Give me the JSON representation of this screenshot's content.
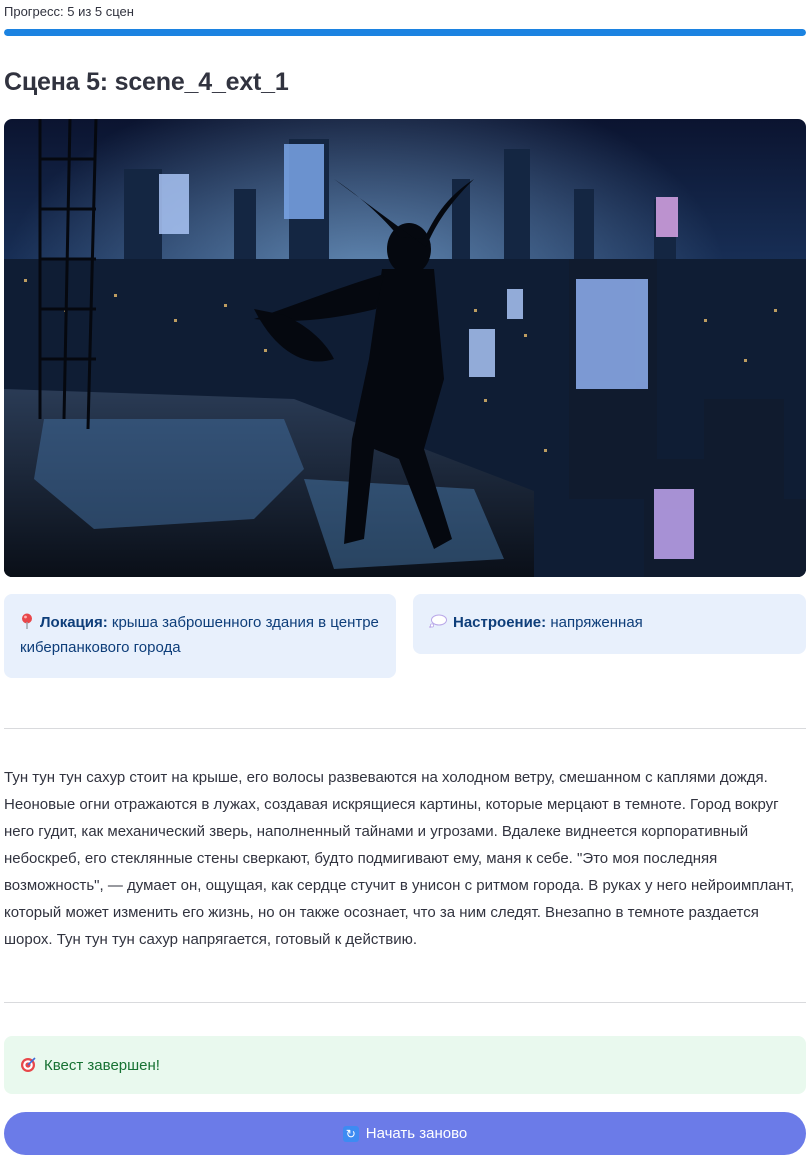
{
  "progress": {
    "label": "Прогресс: 5 из 5 сцен",
    "value": 1.0,
    "color": "#1c83e1"
  },
  "scene": {
    "title": "Сцена 5: scene_4_ext_1",
    "image_icon": "cyberpunk-rooftop-scene"
  },
  "location": {
    "icon": "pin-icon",
    "label": "Локация:",
    "value": "крыша заброшенного здания в центре киберпанкового города"
  },
  "mood": {
    "icon": "thought-bubble-icon",
    "label": "Настроение:",
    "value": "напряженная"
  },
  "story": {
    "text": "Тун тун тун сахур стоит на крыше, его волосы развеваются на холодном ветру, смешанном с каплями дождя. Неоновые огни отражаются в лужах, создавая искрящиеся картины, которые мерцают в темноте. Город вокруг него гудит, как механический зверь, наполненный тайнами и угрозами. Вдалеке виднеется корпоративный небоскреб, его стеклянные стены сверкают, будто подмигивают ему, маня к себе. \"Это моя последняя возможность\", — думает он, ощущая, как сердце стучит в унисон с ритмом города. В руках у него нейроимплант, который может изменить его жизнь, но он также осознает, что за ним следят. Внезапно в темноте раздается шорох. Тун тун тун сахур напрягается, готовый к действию."
  },
  "status": {
    "icon": "target-icon",
    "text": "Квест завершен!"
  },
  "restart_button": {
    "icon": "refresh-icon",
    "label": "Начать заново",
    "color": "#6b7be8"
  }
}
